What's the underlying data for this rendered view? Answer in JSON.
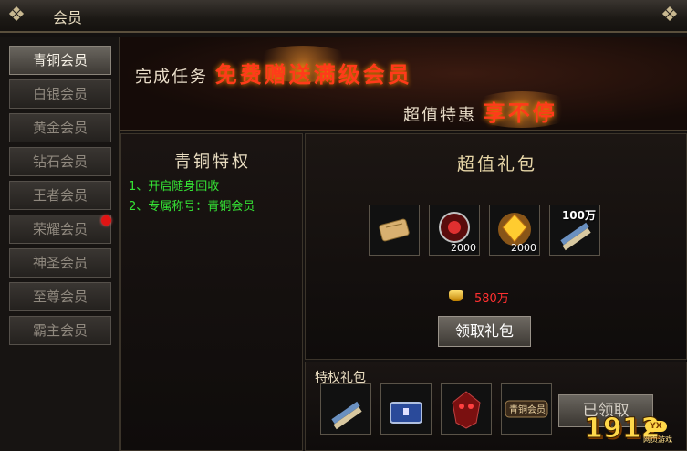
{
  "window": {
    "title": "会员"
  },
  "sidebar": {
    "items": [
      {
        "label": "青铜会员"
      },
      {
        "label": "白银会员"
      },
      {
        "label": "黄金会员"
      },
      {
        "label": "钻石会员"
      },
      {
        "label": "王者会员"
      },
      {
        "label": "荣耀会员"
      },
      {
        "label": "神圣会员"
      },
      {
        "label": "至尊会员"
      },
      {
        "label": "霸主会员"
      }
    ]
  },
  "banner": {
    "line1_prefix": "完成任务",
    "line1_highlight": "免费赠送满级会员",
    "line2_prefix": "超值特惠",
    "line2_highlight": "享不停"
  },
  "privileges": {
    "title": "青铜特权",
    "items": [
      "1、开启随身回收",
      "2、专属称号：青铜会员"
    ]
  },
  "gift_pack": {
    "title": "超值礼包",
    "items": [
      {
        "icon": "scroll-icon",
        "count": ""
      },
      {
        "icon": "red-emblem-icon",
        "count": "2000"
      },
      {
        "icon": "gold-gem-icon",
        "count": "2000"
      },
      {
        "icon": "scroll-bundle-icon",
        "count": "100万"
      }
    ],
    "gold_amount": "580万",
    "claim_label": "领取礼包"
  },
  "privilege_pack": {
    "title": "特权礼包",
    "items": [
      {
        "icon": "scroll-bundle-icon"
      },
      {
        "icon": "treasure-chest-icon"
      },
      {
        "icon": "demon-mask-icon"
      },
      {
        "icon": "bronze-title-badge-icon",
        "label": "青铜会员"
      }
    ],
    "claimed_label": "已领取"
  },
  "watermark": {
    "text": "1912",
    "badge": "YX",
    "sub": "网页游戏"
  }
}
